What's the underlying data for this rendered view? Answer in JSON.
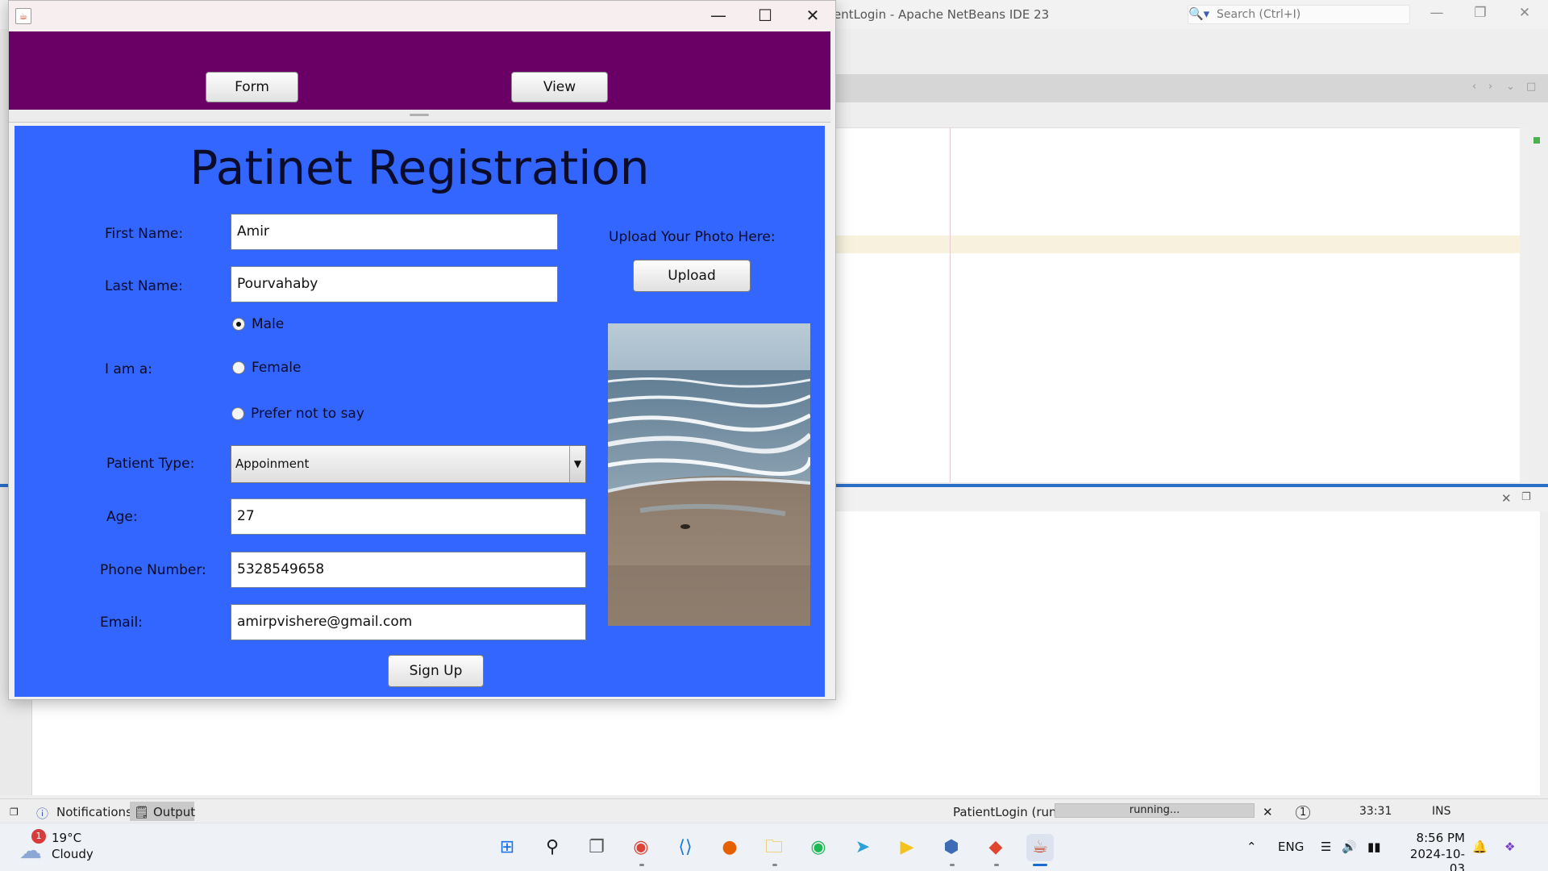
{
  "ide": {
    "title": "entLogin - Apache NetBeans IDE 23",
    "search_placeholder": "Search (Ctrl+I)",
    "status": {
      "notifications_label": "Notifications",
      "output_label": "Output",
      "run_label": "PatientLogin (run)",
      "progress_text": "running...",
      "position": "33:31",
      "mode": "INS",
      "notification_count": "1"
    }
  },
  "taskbar": {
    "temperature": "19°C",
    "condition": "Cloudy",
    "weather_badge": "1",
    "language": "ENG",
    "time": "8:56 PM",
    "date": "2024-10-03",
    "apps": [
      "windows-start",
      "search",
      "task-view",
      "chrome",
      "vscode",
      "firefox",
      "file-explorer",
      "spotify",
      "telegram",
      "potplayer",
      "virtualbox",
      "git",
      "java"
    ]
  },
  "app": {
    "nav": {
      "form_label": "Form",
      "view_label": "View"
    },
    "title": "Patinet Registration",
    "labels": {
      "first_name": "First Name:",
      "last_name": "Last Name:",
      "gender": "I am a:",
      "patient_type": "Patient Type:",
      "age": "Age:",
      "phone": "Phone Number:",
      "email": "Email:",
      "upload_prompt": "Upload Your Photo Here:"
    },
    "values": {
      "first_name": "Amir",
      "last_name": "Pourvahaby",
      "patient_type": "Appoinment",
      "age": "27",
      "phone": "5328549658",
      "email": "amirpvishere@gmail.com"
    },
    "gender_options": {
      "male": "Male",
      "female": "Female",
      "none": "Prefer not to say"
    },
    "gender_selected": "Male",
    "buttons": {
      "upload": "Upload",
      "sign_up": "Sign Up"
    },
    "colors": {
      "nav": "#6a0066",
      "panel": "#3366ff"
    }
  }
}
